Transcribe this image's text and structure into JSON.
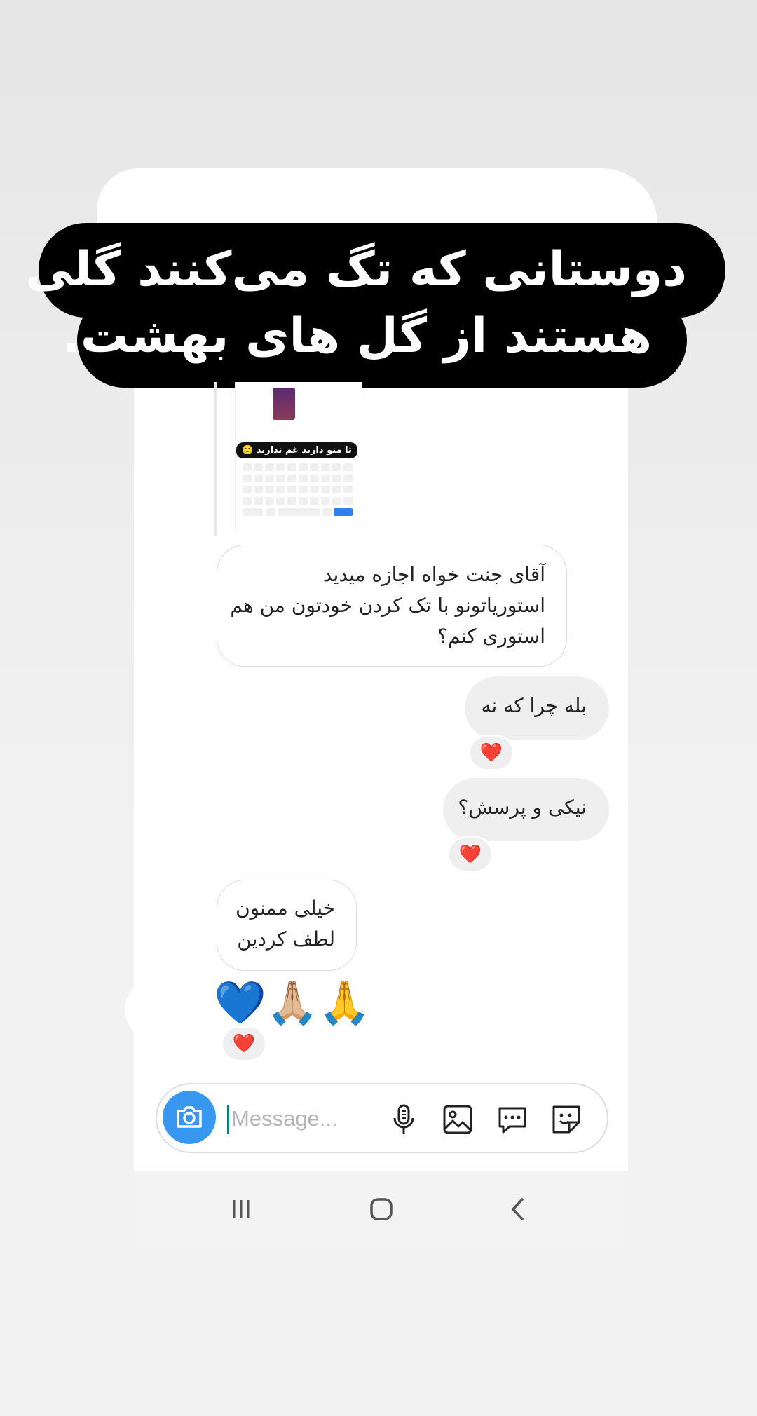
{
  "caption": {
    "line1": "دوستانی که تگ می‌کنند گلی",
    "line2": "هستند از گل های بهشت."
  },
  "shared_story": {
    "caption_text": "تا منو دارید غم ندارید 🙂"
  },
  "messages": {
    "received_1": {
      "line1": "آقای جنت خواه اجازه میدید",
      "line2": "استوریاتونو با تک کردن خودتون من هم",
      "line3": "استوری کنم؟"
    },
    "sent_1": {
      "text": "بله چرا که نه",
      "reaction": "❤️"
    },
    "sent_2": {
      "text": "نیکی و پرسش؟",
      "reaction": "❤️"
    },
    "received_2": {
      "line1": "خیلی ممنون",
      "line2": "لطف کردین"
    },
    "received_3": {
      "text": "💙🙏🏼🙏",
      "reaction": "❤️"
    }
  },
  "composer": {
    "placeholder": "Message...",
    "icons": [
      "camera-icon",
      "microphone-icon",
      "gallery-icon",
      "chat-bubble-icon",
      "sticker-icon"
    ]
  },
  "navbar": {
    "icons": [
      "recent-apps-icon",
      "home-icon",
      "back-icon"
    ]
  },
  "colors": {
    "camera_button": "#3897f0",
    "reaction_heart": "#e0245e",
    "caption_bg": "#000000"
  }
}
